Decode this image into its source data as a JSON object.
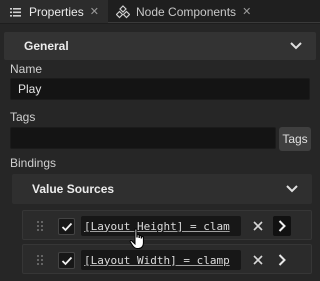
{
  "tabs": [
    {
      "label": "Properties",
      "icon": "list-icon",
      "active": true
    },
    {
      "label": "Node Components",
      "icon": "nodes-icon",
      "active": false
    }
  ],
  "general": {
    "title": "General"
  },
  "fields": {
    "name_label": "Name",
    "name_value": "Play",
    "tags_label": "Tags",
    "tags_value": "",
    "tags_button": "Tags",
    "bindings_label": "Bindings"
  },
  "value_sources": {
    "title": "Value Sources",
    "items": [
      {
        "expression": "[Layout Height] = clam",
        "enabled": true
      },
      {
        "expression": "[Layout Width] = clamp",
        "enabled": true
      }
    ]
  },
  "colors": {
    "panel": "#262626",
    "field": "#141414",
    "accent_text": "#ececec"
  }
}
